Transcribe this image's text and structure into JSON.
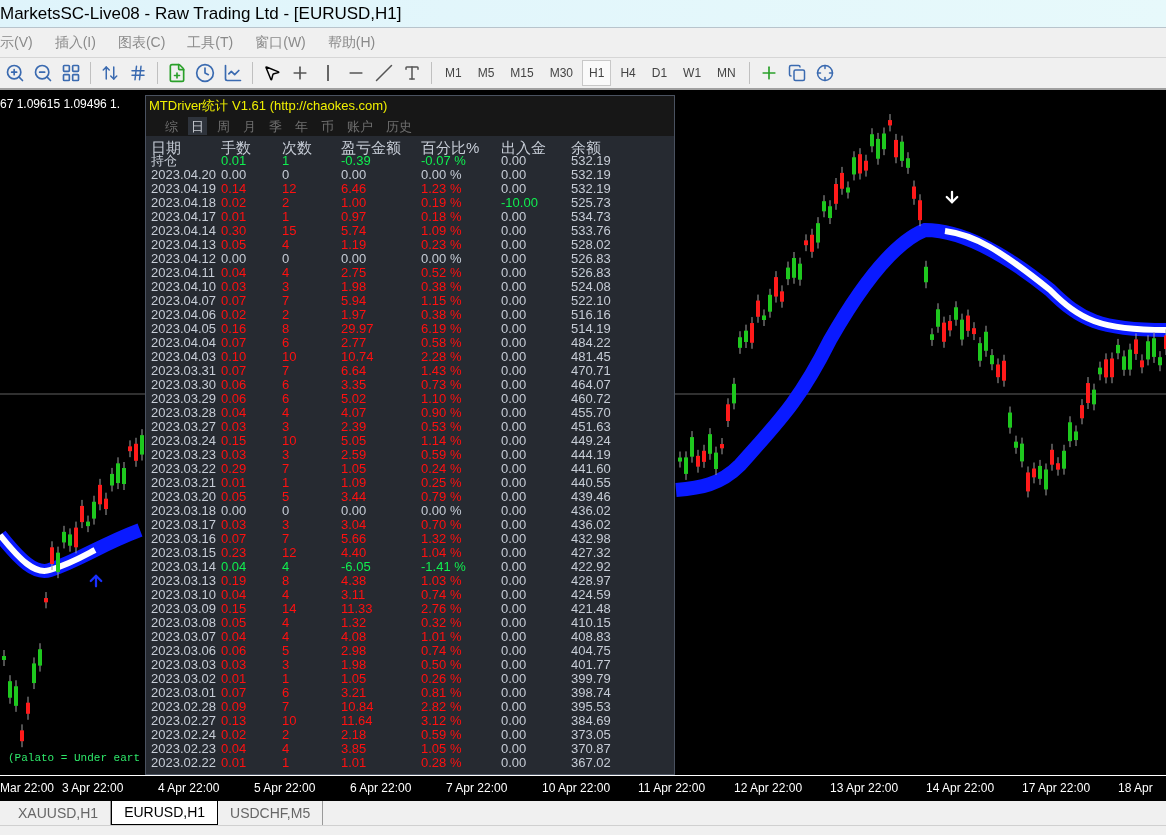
{
  "window": {
    "title": "MarketsSC-Live08 - Raw Trading Ltd - [EURUSD,H1]"
  },
  "menu": [
    "示(V)",
    "插入(I)",
    "图表(C)",
    "工具(T)",
    "窗口(W)",
    "帮助(H)"
  ],
  "timeframes": [
    {
      "label": "M1",
      "selected": false
    },
    {
      "label": "M5",
      "selected": false
    },
    {
      "label": "M15",
      "selected": false
    },
    {
      "label": "M30",
      "selected": false
    },
    {
      "label": "H1",
      "selected": true
    },
    {
      "label": "H4",
      "selected": false
    },
    {
      "label": "D1",
      "selected": false
    },
    {
      "label": "W1",
      "selected": false
    },
    {
      "label": "MN",
      "selected": false
    }
  ],
  "chart": {
    "quote": "67 1.09615 1.09496 1.",
    "comment": "(Palato = Under eart",
    "time_axis": [
      "Mar 22:00",
      "3 Apr 22:00",
      "4 Apr 22:00",
      "5 Apr 22:00",
      "6 Apr 22:00",
      "7 Apr 22:00",
      "10 Apr 22:00",
      "11 Apr 22:00",
      "12 Apr 22:00",
      "13 Apr 22:00",
      "14 Apr 22:00",
      "17 Apr 22:00",
      "18 Apr"
    ]
  },
  "panel": {
    "title": "MTDriver统计  V1.61  (http://chaokes.com)",
    "tabs": [
      {
        "label": "综",
        "selected": false
      },
      {
        "label": "日",
        "selected": true
      },
      {
        "label": "周",
        "selected": false
      },
      {
        "label": "月",
        "selected": false
      },
      {
        "label": "季",
        "selected": false
      },
      {
        "label": "年",
        "selected": false
      },
      {
        "label": "币",
        "selected": false
      },
      {
        "label": "账户",
        "selected": false
      },
      {
        "label": "历史",
        "selected": false
      }
    ],
    "columns": [
      "日期",
      "手数",
      "次数",
      "盈亏金额",
      "百分比%",
      "出入金",
      "余额"
    ],
    "rows": [
      {
        "date": "持仓",
        "lots": "0.01",
        "count": "1",
        "pnl": "-0.39",
        "pct": "-0.07 %",
        "flow": "0.00",
        "balance": "532.19",
        "kind": "loss",
        "withdrawal": false
      },
      {
        "date": "2023.04.20",
        "lots": "0.00",
        "count": "0",
        "pnl": "0.00",
        "pct": "0.00 %",
        "flow": "0.00",
        "balance": "532.19",
        "kind": "flat",
        "withdrawal": false
      },
      {
        "date": "2023.04.19",
        "lots": "0.14",
        "count": "12",
        "pnl": "6.46",
        "pct": "1.23 %",
        "flow": "0.00",
        "balance": "532.19",
        "kind": "gain",
        "withdrawal": false
      },
      {
        "date": "2023.04.18",
        "lots": "0.02",
        "count": "2",
        "pnl": "1.00",
        "pct": "0.19 %",
        "flow": "-10.00",
        "balance": "525.73",
        "kind": "gain",
        "withdrawal": true
      },
      {
        "date": "2023.04.17",
        "lots": "0.01",
        "count": "1",
        "pnl": "0.97",
        "pct": "0.18 %",
        "flow": "0.00",
        "balance": "534.73",
        "kind": "gain",
        "withdrawal": false
      },
      {
        "date": "2023.04.14",
        "lots": "0.30",
        "count": "15",
        "pnl": "5.74",
        "pct": "1.09 %",
        "flow": "0.00",
        "balance": "533.76",
        "kind": "gain",
        "withdrawal": false
      },
      {
        "date": "2023.04.13",
        "lots": "0.05",
        "count": "4",
        "pnl": "1.19",
        "pct": "0.23 %",
        "flow": "0.00",
        "balance": "528.02",
        "kind": "gain",
        "withdrawal": false
      },
      {
        "date": "2023.04.12",
        "lots": "0.00",
        "count": "0",
        "pnl": "0.00",
        "pct": "0.00 %",
        "flow": "0.00",
        "balance": "526.83",
        "kind": "flat",
        "withdrawal": false
      },
      {
        "date": "2023.04.11",
        "lots": "0.04",
        "count": "4",
        "pnl": "2.75",
        "pct": "0.52 %",
        "flow": "0.00",
        "balance": "526.83",
        "kind": "gain",
        "withdrawal": false
      },
      {
        "date": "2023.04.10",
        "lots": "0.03",
        "count": "3",
        "pnl": "1.98",
        "pct": "0.38 %",
        "flow": "0.00",
        "balance": "524.08",
        "kind": "gain",
        "withdrawal": false
      },
      {
        "date": "2023.04.07",
        "lots": "0.07",
        "count": "7",
        "pnl": "5.94",
        "pct": "1.15 %",
        "flow": "0.00",
        "balance": "522.10",
        "kind": "gain",
        "withdrawal": false
      },
      {
        "date": "2023.04.06",
        "lots": "0.02",
        "count": "2",
        "pnl": "1.97",
        "pct": "0.38 %",
        "flow": "0.00",
        "balance": "516.16",
        "kind": "gain",
        "withdrawal": false
      },
      {
        "date": "2023.04.05",
        "lots": "0.16",
        "count": "8",
        "pnl": "29.97",
        "pct": "6.19 %",
        "flow": "0.00",
        "balance": "514.19",
        "kind": "gain",
        "withdrawal": false
      },
      {
        "date": "2023.04.04",
        "lots": "0.07",
        "count": "6",
        "pnl": "2.77",
        "pct": "0.58 %",
        "flow": "0.00",
        "balance": "484.22",
        "kind": "gain",
        "withdrawal": false
      },
      {
        "date": "2023.04.03",
        "lots": "0.10",
        "count": "10",
        "pnl": "10.74",
        "pct": "2.28 %",
        "flow": "0.00",
        "balance": "481.45",
        "kind": "gain",
        "withdrawal": false
      },
      {
        "date": "2023.03.31",
        "lots": "0.07",
        "count": "7",
        "pnl": "6.64",
        "pct": "1.43 %",
        "flow": "0.00",
        "balance": "470.71",
        "kind": "gain",
        "withdrawal": false
      },
      {
        "date": "2023.03.30",
        "lots": "0.06",
        "count": "6",
        "pnl": "3.35",
        "pct": "0.73 %",
        "flow": "0.00",
        "balance": "464.07",
        "kind": "gain",
        "withdrawal": false
      },
      {
        "date": "2023.03.29",
        "lots": "0.06",
        "count": "6",
        "pnl": "5.02",
        "pct": "1.10 %",
        "flow": "0.00",
        "balance": "460.72",
        "kind": "gain",
        "withdrawal": false
      },
      {
        "date": "2023.03.28",
        "lots": "0.04",
        "count": "4",
        "pnl": "4.07",
        "pct": "0.90 %",
        "flow": "0.00",
        "balance": "455.70",
        "kind": "gain",
        "withdrawal": false
      },
      {
        "date": "2023.03.27",
        "lots": "0.03",
        "count": "3",
        "pnl": "2.39",
        "pct": "0.53 %",
        "flow": "0.00",
        "balance": "451.63",
        "kind": "gain",
        "withdrawal": false
      },
      {
        "date": "2023.03.24",
        "lots": "0.15",
        "count": "10",
        "pnl": "5.05",
        "pct": "1.14 %",
        "flow": "0.00",
        "balance": "449.24",
        "kind": "gain",
        "withdrawal": false
      },
      {
        "date": "2023.03.23",
        "lots": "0.03",
        "count": "3",
        "pnl": "2.59",
        "pct": "0.59 %",
        "flow": "0.00",
        "balance": "444.19",
        "kind": "gain",
        "withdrawal": false
      },
      {
        "date": "2023.03.22",
        "lots": "0.29",
        "count": "7",
        "pnl": "1.05",
        "pct": "0.24 %",
        "flow": "0.00",
        "balance": "441.60",
        "kind": "gain",
        "withdrawal": false
      },
      {
        "date": "2023.03.21",
        "lots": "0.01",
        "count": "1",
        "pnl": "1.09",
        "pct": "0.25 %",
        "flow": "0.00",
        "balance": "440.55",
        "kind": "gain",
        "withdrawal": false
      },
      {
        "date": "2023.03.20",
        "lots": "0.05",
        "count": "5",
        "pnl": "3.44",
        "pct": "0.79 %",
        "flow": "0.00",
        "balance": "439.46",
        "kind": "gain",
        "withdrawal": false
      },
      {
        "date": "2023.03.18",
        "lots": "0.00",
        "count": "0",
        "pnl": "0.00",
        "pct": "0.00 %",
        "flow": "0.00",
        "balance": "436.02",
        "kind": "flat",
        "withdrawal": false
      },
      {
        "date": "2023.03.17",
        "lots": "0.03",
        "count": "3",
        "pnl": "3.04",
        "pct": "0.70 %",
        "flow": "0.00",
        "balance": "436.02",
        "kind": "gain",
        "withdrawal": false
      },
      {
        "date": "2023.03.16",
        "lots": "0.07",
        "count": "7",
        "pnl": "5.66",
        "pct": "1.32 %",
        "flow": "0.00",
        "balance": "432.98",
        "kind": "gain",
        "withdrawal": false
      },
      {
        "date": "2023.03.15",
        "lots": "0.23",
        "count": "12",
        "pnl": "4.40",
        "pct": "1.04 %",
        "flow": "0.00",
        "balance": "427.32",
        "kind": "gain",
        "withdrawal": false
      },
      {
        "date": "2023.03.14",
        "lots": "0.04",
        "count": "4",
        "pnl": "-6.05",
        "pct": "-1.41 %",
        "flow": "0.00",
        "balance": "422.92",
        "kind": "loss",
        "withdrawal": false
      },
      {
        "date": "2023.03.13",
        "lots": "0.19",
        "count": "8",
        "pnl": "4.38",
        "pct": "1.03 %",
        "flow": "0.00",
        "balance": "428.97",
        "kind": "gain",
        "withdrawal": false
      },
      {
        "date": "2023.03.10",
        "lots": "0.04",
        "count": "4",
        "pnl": "3.11",
        "pct": "0.74 %",
        "flow": "0.00",
        "balance": "424.59",
        "kind": "gain",
        "withdrawal": false
      },
      {
        "date": "2023.03.09",
        "lots": "0.15",
        "count": "14",
        "pnl": "11.33",
        "pct": "2.76 %",
        "flow": "0.00",
        "balance": "421.48",
        "kind": "gain",
        "withdrawal": false
      },
      {
        "date": "2023.03.08",
        "lots": "0.05",
        "count": "4",
        "pnl": "1.32",
        "pct": "0.32 %",
        "flow": "0.00",
        "balance": "410.15",
        "kind": "gain",
        "withdrawal": false
      },
      {
        "date": "2023.03.07",
        "lots": "0.04",
        "count": "4",
        "pnl": "4.08",
        "pct": "1.01 %",
        "flow": "0.00",
        "balance": "408.83",
        "kind": "gain",
        "withdrawal": false
      },
      {
        "date": "2023.03.06",
        "lots": "0.06",
        "count": "5",
        "pnl": "2.98",
        "pct": "0.74 %",
        "flow": "0.00",
        "balance": "404.75",
        "kind": "gain",
        "withdrawal": false
      },
      {
        "date": "2023.03.03",
        "lots": "0.03",
        "count": "3",
        "pnl": "1.98",
        "pct": "0.50 %",
        "flow": "0.00",
        "balance": "401.77",
        "kind": "gain",
        "withdrawal": false
      },
      {
        "date": "2023.03.02",
        "lots": "0.01",
        "count": "1",
        "pnl": "1.05",
        "pct": "0.26 %",
        "flow": "0.00",
        "balance": "399.79",
        "kind": "gain",
        "withdrawal": false
      },
      {
        "date": "2023.03.01",
        "lots": "0.07",
        "count": "6",
        "pnl": "3.21",
        "pct": "0.81 %",
        "flow": "0.00",
        "balance": "398.74",
        "kind": "gain",
        "withdrawal": false
      },
      {
        "date": "2023.02.28",
        "lots": "0.09",
        "count": "7",
        "pnl": "10.84",
        "pct": "2.82 %",
        "flow": "0.00",
        "balance": "395.53",
        "kind": "gain",
        "withdrawal": false
      },
      {
        "date": "2023.02.27",
        "lots": "0.13",
        "count": "10",
        "pnl": "11.64",
        "pct": "3.12 %",
        "flow": "0.00",
        "balance": "384.69",
        "kind": "gain",
        "withdrawal": false
      },
      {
        "date": "2023.02.24",
        "lots": "0.02",
        "count": "2",
        "pnl": "2.18",
        "pct": "0.59 %",
        "flow": "0.00",
        "balance": "373.05",
        "kind": "gain",
        "withdrawal": false
      },
      {
        "date": "2023.02.23",
        "lots": "0.04",
        "count": "4",
        "pnl": "3.85",
        "pct": "1.05 %",
        "flow": "0.00",
        "balance": "370.87",
        "kind": "gain",
        "withdrawal": false
      },
      {
        "date": "2023.02.22",
        "lots": "0.01",
        "count": "1",
        "pnl": "1.01",
        "pct": "0.28 %",
        "flow": "0.00",
        "balance": "367.02",
        "kind": "gain",
        "withdrawal": false
      }
    ]
  },
  "chart_tabs": [
    {
      "label": "XAUUSD,H1",
      "selected": false
    },
    {
      "label": "EURUSD,H1",
      "selected": true
    },
    {
      "label": "USDCHF,M5",
      "selected": false
    }
  ]
}
